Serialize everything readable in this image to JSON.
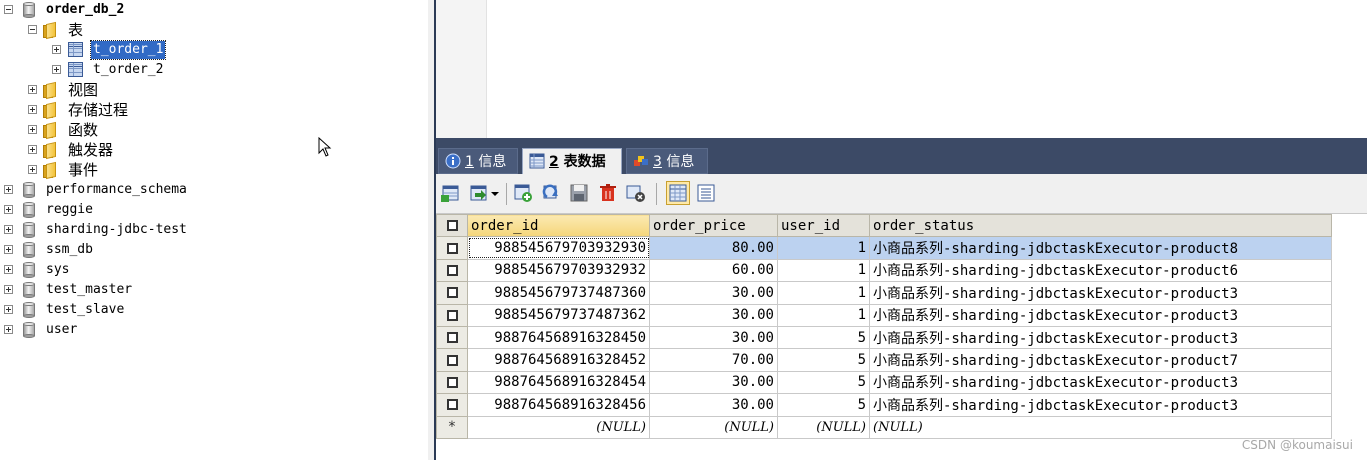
{
  "tree": {
    "items": [
      {
        "label": "order_db_2",
        "type": "db",
        "expanded": true,
        "bold": true
      },
      {
        "label": "表",
        "type": "folder",
        "expanded": true
      },
      {
        "label": "t_order_1",
        "type": "table",
        "selected": true
      },
      {
        "label": "t_order_2",
        "type": "table"
      },
      {
        "label": "视图",
        "type": "folder"
      },
      {
        "label": "存储过程",
        "type": "folder"
      },
      {
        "label": "函数",
        "type": "folder"
      },
      {
        "label": "触发器",
        "type": "folder"
      },
      {
        "label": "事件",
        "type": "folder"
      },
      {
        "label": "performance_schema",
        "type": "db"
      },
      {
        "label": "reggie",
        "type": "db"
      },
      {
        "label": "sharding-jdbc-test",
        "type": "db"
      },
      {
        "label": "ssm_db",
        "type": "db"
      },
      {
        "label": "sys",
        "type": "db"
      },
      {
        "label": "test_master",
        "type": "db"
      },
      {
        "label": "test_slave",
        "type": "db"
      },
      {
        "label": "user",
        "type": "db"
      }
    ]
  },
  "tabs": [
    {
      "num": "1",
      "label": " 信息",
      "icon": "info-icon"
    },
    {
      "num": "2",
      "label": " 表数据",
      "icon": "table-data-icon",
      "active": true
    },
    {
      "num": "3",
      "label": " 信息",
      "icon": "info-objects-icon"
    }
  ],
  "toolbar": {
    "icons": [
      "insert-row-icon",
      "export-icon",
      "dropdown-arrow-icon",
      "add-record-icon",
      "refresh-icon",
      "save-icon",
      "delete-icon",
      "cancel-icon",
      "grid-view-icon",
      "form-view-icon"
    ]
  },
  "grid": {
    "columns": [
      "order_id",
      "order_price",
      "user_id",
      "order_status"
    ],
    "rows": [
      [
        "988545679703932930",
        "80.00",
        "1",
        "小商品系列-sharding-jdbctaskExecutor-product8"
      ],
      [
        "988545679703932932",
        "60.00",
        "1",
        "小商品系列-sharding-jdbctaskExecutor-product6"
      ],
      [
        "988545679737487360",
        "30.00",
        "1",
        "小商品系列-sharding-jdbctaskExecutor-product3"
      ],
      [
        "988545679737487362",
        "30.00",
        "1",
        "小商品系列-sharding-jdbctaskExecutor-product3"
      ],
      [
        "988764568916328450",
        "30.00",
        "5",
        "小商品系列-sharding-jdbctaskExecutor-product3"
      ],
      [
        "988764568916328452",
        "70.00",
        "5",
        "小商品系列-sharding-jdbctaskExecutor-product7"
      ],
      [
        "988764568916328454",
        "30.00",
        "5",
        "小商品系列-sharding-jdbctaskExecutor-product3"
      ],
      [
        "988764568916328456",
        "30.00",
        "5",
        "小商品系列-sharding-jdbctaskExecutor-product3"
      ]
    ],
    "new_row": {
      "marker": "*",
      "values": [
        "(NULL)",
        "(NULL)",
        "(NULL)",
        "(NULL)"
      ]
    }
  },
  "watermark": "CSDN @koumaisui",
  "colors": {
    "selection": "#316ac5",
    "tab_bar": "#3c4a66",
    "header": "#e4e2da"
  }
}
